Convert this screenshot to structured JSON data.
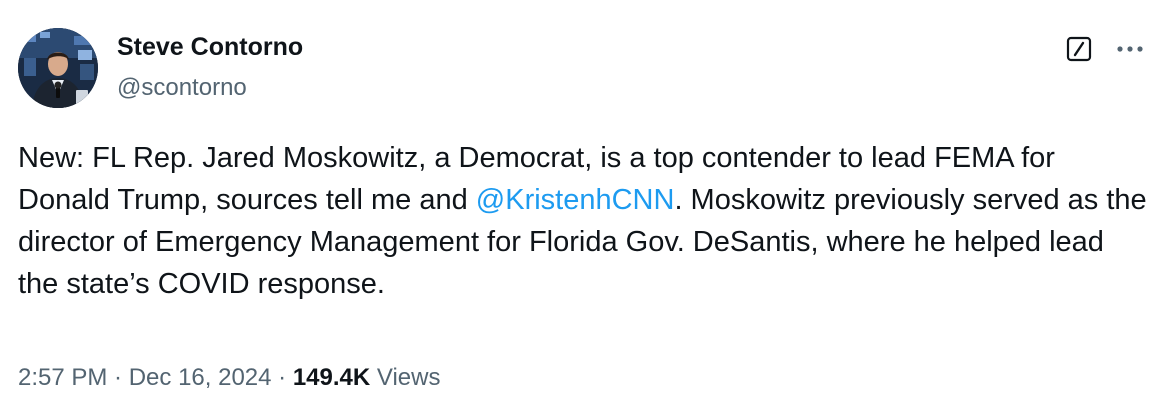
{
  "author": {
    "display_name": "Steve Contorno",
    "handle": "@scontorno"
  },
  "icons": {
    "grok": "grok-icon",
    "more": "more-icon"
  },
  "tweet": {
    "text_part1": "New: FL Rep. Jared Moskowitz, a Democrat, is a top contender to lead FEMA for Donald Trump, sources tell me and ",
    "mention": "@KristenhCNN",
    "text_part2": ". Moskowitz previously served as the director of Emergency Management for Florida Gov. DeSantis, where he helped lead the state’s COVID response."
  },
  "meta": {
    "time": "2:57 PM",
    "separator": " · ",
    "date": "Dec 16, 2024",
    "views_count": "149.4K",
    "views_label": "Views"
  },
  "colors": {
    "text": "#0f1419",
    "secondary": "#536471",
    "link": "#1d9bf0"
  }
}
